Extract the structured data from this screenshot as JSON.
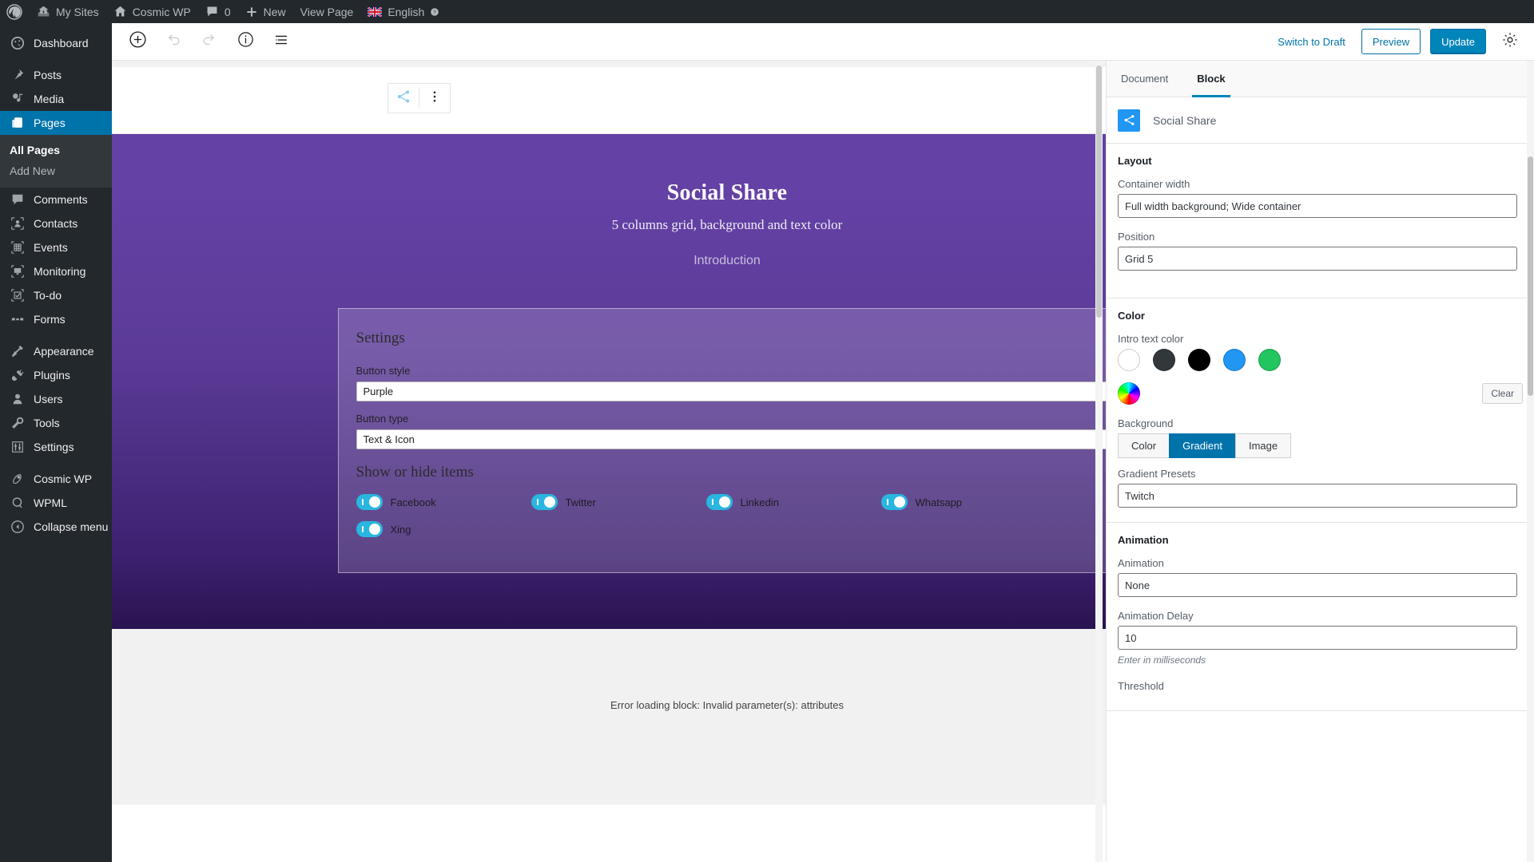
{
  "adminbar": {
    "items": [
      {
        "icon": "wordpress-logo-icon",
        "label": ""
      },
      {
        "icon": "my-sites-icon",
        "label": "My Sites"
      },
      {
        "icon": "site-home-icon",
        "label": "Cosmic WP"
      },
      {
        "icon": "comment-bubble-icon",
        "label": "0"
      },
      {
        "icon": "plus-icon",
        "label": "New"
      },
      {
        "icon": "",
        "label": "View Page"
      },
      {
        "icon": "uk-flag-icon",
        "label": "English"
      }
    ]
  },
  "sidebar": {
    "items": [
      {
        "label": "Dashboard",
        "icon": "dashboard-icon",
        "current": false
      },
      {
        "label": "Posts",
        "icon": "pin-icon",
        "current": false
      },
      {
        "label": "Media",
        "icon": "media-icon",
        "current": false
      },
      {
        "label": "Pages",
        "icon": "pages-icon",
        "current": true
      },
      {
        "label": "Comments",
        "icon": "comments-icon",
        "current": false
      },
      {
        "label": "Contacts",
        "icon": "contacts-icon",
        "current": false
      },
      {
        "label": "Events",
        "icon": "events-icon",
        "current": false
      },
      {
        "label": "Monitoring",
        "icon": "monitoring-icon",
        "current": false
      },
      {
        "label": "To-do",
        "icon": "todo-icon",
        "current": false
      },
      {
        "label": "Forms",
        "icon": "forms-icon",
        "current": false
      },
      {
        "label": "Appearance",
        "icon": "appearance-icon",
        "current": false
      },
      {
        "label": "Plugins",
        "icon": "plugins-icon",
        "current": false
      },
      {
        "label": "Users",
        "icon": "users-icon",
        "current": false
      },
      {
        "label": "Tools",
        "icon": "tools-icon",
        "current": false
      },
      {
        "label": "Settings",
        "icon": "settings-icon",
        "current": false
      },
      {
        "label": "Cosmic WP",
        "icon": "cosmic-wp-icon",
        "current": false
      },
      {
        "label": "WPML",
        "icon": "wpml-icon",
        "current": false
      },
      {
        "label": "Collapse menu",
        "icon": "collapse-icon",
        "current": false
      }
    ],
    "submenu": [
      {
        "label": "All Pages",
        "current": true
      },
      {
        "label": "Add New",
        "current": false
      }
    ]
  },
  "header": {
    "add_block": "add-block-icon",
    "undo": "undo-icon",
    "redo": "redo-icon",
    "info": "info-icon",
    "block_navigation": "block-navigation-icon",
    "switch_to_draft": "Switch to Draft",
    "preview": "Preview",
    "update": "Update",
    "settings_gear": "gear-icon"
  },
  "block_toolbar": {
    "block_type_icon": "social-share-icon",
    "more_options_icon": "vertical-dots-icon"
  },
  "canvas": {
    "title": "Social Share",
    "subtitle": "5 columns grid, background and text color",
    "intro": "Introduction",
    "settings_heading": "Settings",
    "fields": [
      {
        "label": "Button style",
        "value": "Purple"
      },
      {
        "label": "Button type",
        "value": "Text & Icon"
      }
    ],
    "toggles_heading": "Show or hide items",
    "toggles": [
      {
        "label": "Facebook",
        "on": true
      },
      {
        "label": "Twitter",
        "on": true
      },
      {
        "label": "Linkedin",
        "on": true
      },
      {
        "label": "Whatsapp",
        "on": true
      },
      {
        "label": "Xing",
        "on": true
      }
    ],
    "error_message": "Error loading block: Invalid parameter(s): attributes"
  },
  "inspector": {
    "tabs": [
      {
        "label": "Document",
        "active": false
      },
      {
        "label": "Block",
        "active": true
      }
    ],
    "block_name": "Social Share",
    "block_icon": "social-share-icon",
    "layout": {
      "title": "Layout",
      "container_width_label": "Container width",
      "container_width_value": "Full width background; Wide container",
      "position_label": "Position",
      "position_value": "Grid 5"
    },
    "color": {
      "title": "Color",
      "intro_text_color_label": "Intro text color",
      "swatches": [
        "#ffffff",
        "#32373c",
        "#000000",
        "#2196f3",
        "#22c55e",
        "#rainbow"
      ],
      "clear_label": "Clear",
      "background_label": "Background",
      "background_options": [
        {
          "label": "Color",
          "active": false
        },
        {
          "label": "Gradient",
          "active": true
        },
        {
          "label": "Image",
          "active": false
        }
      ],
      "gradient_presets_label": "Gradient Presets",
      "gradient_presets_value": "Twitch"
    },
    "animation": {
      "title": "Animation",
      "animation_label": "Animation",
      "animation_value": "None",
      "delay_label": "Animation Delay",
      "delay_value": "10",
      "delay_help": "Enter in milliseconds",
      "threshold_label": "Threshold"
    }
  },
  "colors": {
    "admin_dark": "#23282d",
    "admin_blue": "#0073aa",
    "accent_blue": "#0085ba",
    "toggle_blue": "#29b6e0",
    "block_purple": "#6441a5"
  }
}
